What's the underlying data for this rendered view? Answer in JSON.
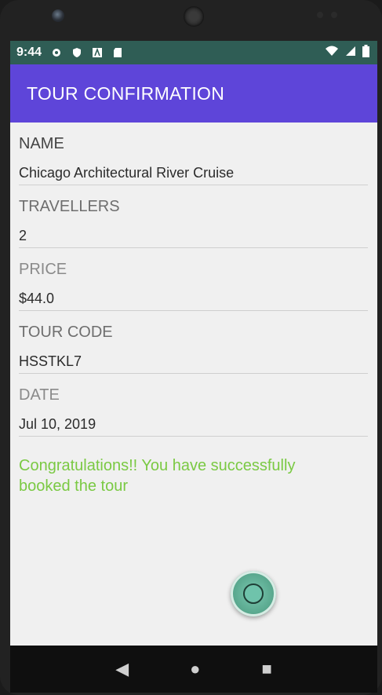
{
  "status_bar": {
    "time": "9:44",
    "icons": [
      "gear-icon",
      "shield-icon",
      "a-icon",
      "sd-card-icon"
    ],
    "right_icons": [
      "wifi-icon",
      "signal-icon",
      "battery-icon"
    ]
  },
  "appbar": {
    "title": "TOUR CONFIRMATION"
  },
  "fields": [
    {
      "label": "NAME",
      "value": "Chicago Architectural River Cruise"
    },
    {
      "label": "TRAVELLERS",
      "value": "2"
    },
    {
      "label": "PRICE",
      "value": "$44.0"
    },
    {
      "label": "TOUR CODE",
      "value": "HSSTKL7"
    },
    {
      "label": "DATE",
      "value": "Jul 10, 2019"
    }
  ],
  "message": "Congratulations!! You have successfully booked the tour",
  "colors": {
    "appbar": "#5e45d9",
    "statusbar": "#2f5d55",
    "success_text": "#7ac943"
  },
  "nav": {
    "back": "◀",
    "home": "●",
    "recents": "■"
  }
}
